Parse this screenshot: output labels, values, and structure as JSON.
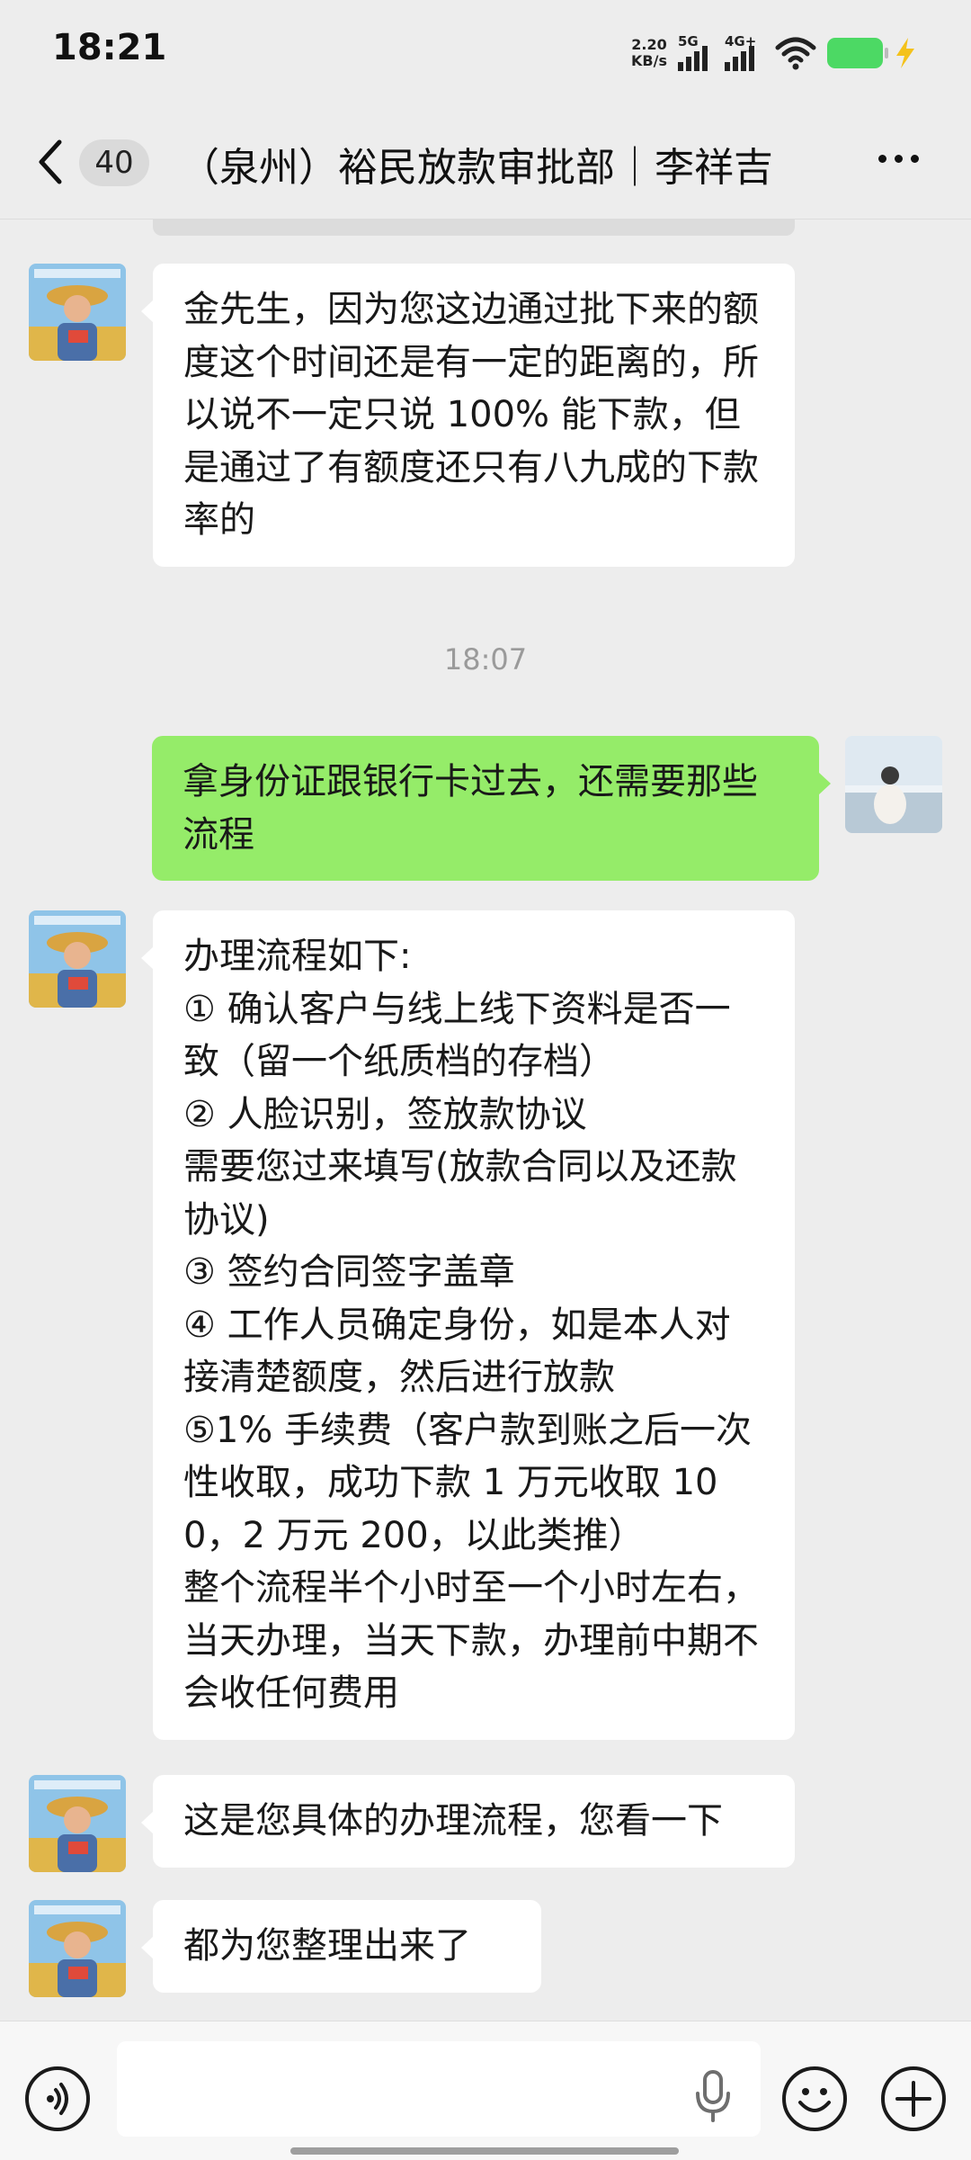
{
  "status_bar": {
    "time": "18:21",
    "net_speed_value": "2.20",
    "net_speed_unit": "KB/s",
    "signal1_label": "5G",
    "signal2_label": "4G+",
    "battery_color": "#4cd964",
    "icons": [
      "signal-5g-icon",
      "signal-4g-icon",
      "wifi-icon",
      "battery-icon",
      "charging-bolt-icon"
    ]
  },
  "header": {
    "unread_count": "40",
    "title": "（泉州）裕民放款审批部｜李祥吉",
    "icons": [
      "back-chevron-icon",
      "more-dots-icon"
    ]
  },
  "timestamp": "18:07",
  "messages": [
    {
      "side": "in",
      "text": "金先生，因为您这边通过批下来的额度这个时间还是有一定的距离的，所以说不一定只说 100% 能下款，但是通过了有额度还只有八九成的下款率的"
    },
    {
      "side": "out",
      "text": "拿身份证跟银行卡过去，还需要那些流程"
    },
    {
      "side": "in",
      "text": "办理流程如下:\n① 确认客户与线上线下资料是否一致（留一个纸质档的存档）\n② 人脸识别，签放款协议\n需要您过来填写(放款合同以及还款协议)\n③ 签约合同签字盖章\n④ 工作人员确定身份，如是本人对接清楚额度，然后进行放款\n⑤1% 手续费（客户款到账之后一次性收取，成功下款 1 万元收取 100，2 万元 200，以此类推）\n整个流程半个小时至一个小时左右，当天办理，当天下款，办理前中期不会收任何费用"
    },
    {
      "side": "in",
      "text": "这是您具体的办理流程，您看一下"
    },
    {
      "side": "in",
      "text": "都为您整理出来了"
    }
  ],
  "colors": {
    "background": "#ededed",
    "incoming_bubble": "#ffffff",
    "outgoing_bubble": "#95ec69"
  },
  "input_bar": {
    "icons": [
      "voice-icon",
      "microphone-icon",
      "emoji-icon",
      "plus-icon"
    ]
  }
}
